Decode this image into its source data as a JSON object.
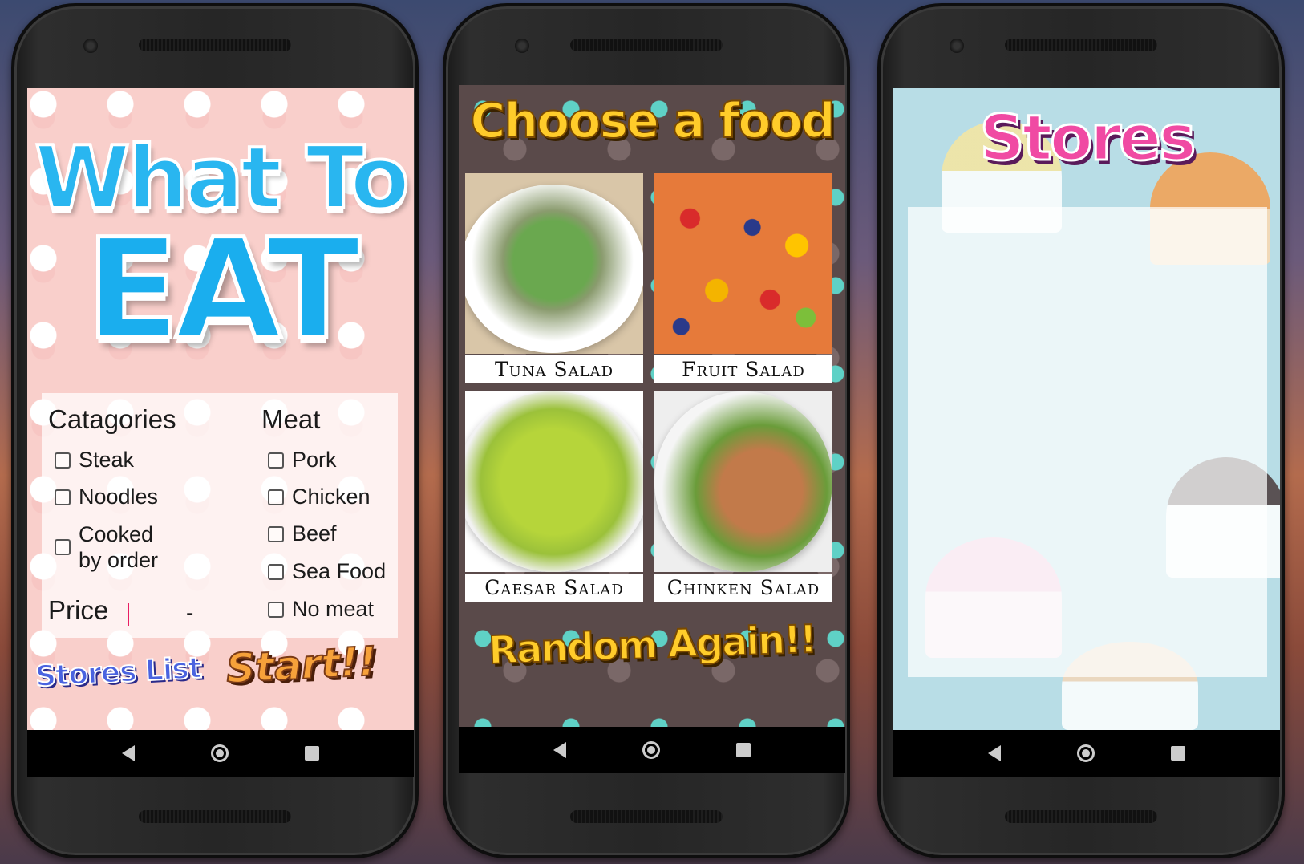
{
  "phones": [
    {
      "screen": "home",
      "title_line1": "What To",
      "title_line2": "EAT",
      "categories_label": "Catagories",
      "categories": [
        "Steak",
        "Noodles",
        "Cooked by order"
      ],
      "meat_label": "Meat",
      "meats": [
        "Pork",
        "Chicken",
        "Beef",
        "Sea Food",
        "No meat"
      ],
      "price_label": "Price",
      "price_separator": "-",
      "stores_list_button": "Stores List",
      "start_button": "Start!!"
    },
    {
      "screen": "choose",
      "title": "Choose a food",
      "foods": [
        "Tuna Salad",
        "Fruit Salad",
        "Caesar Salad",
        "Chinken Salad"
      ],
      "random_button": "Random Again!!"
    },
    {
      "screen": "stores",
      "title": "Stores"
    }
  ],
  "nav_icons": [
    "back-icon",
    "home-icon",
    "recents-icon"
  ],
  "colors": {
    "home_title": "#29b6f0",
    "choose_title": "#ffcc2a",
    "stores_title": "#f04aa3",
    "start_button": "#f6a13a",
    "stores_list_button": "#4a63e0"
  }
}
